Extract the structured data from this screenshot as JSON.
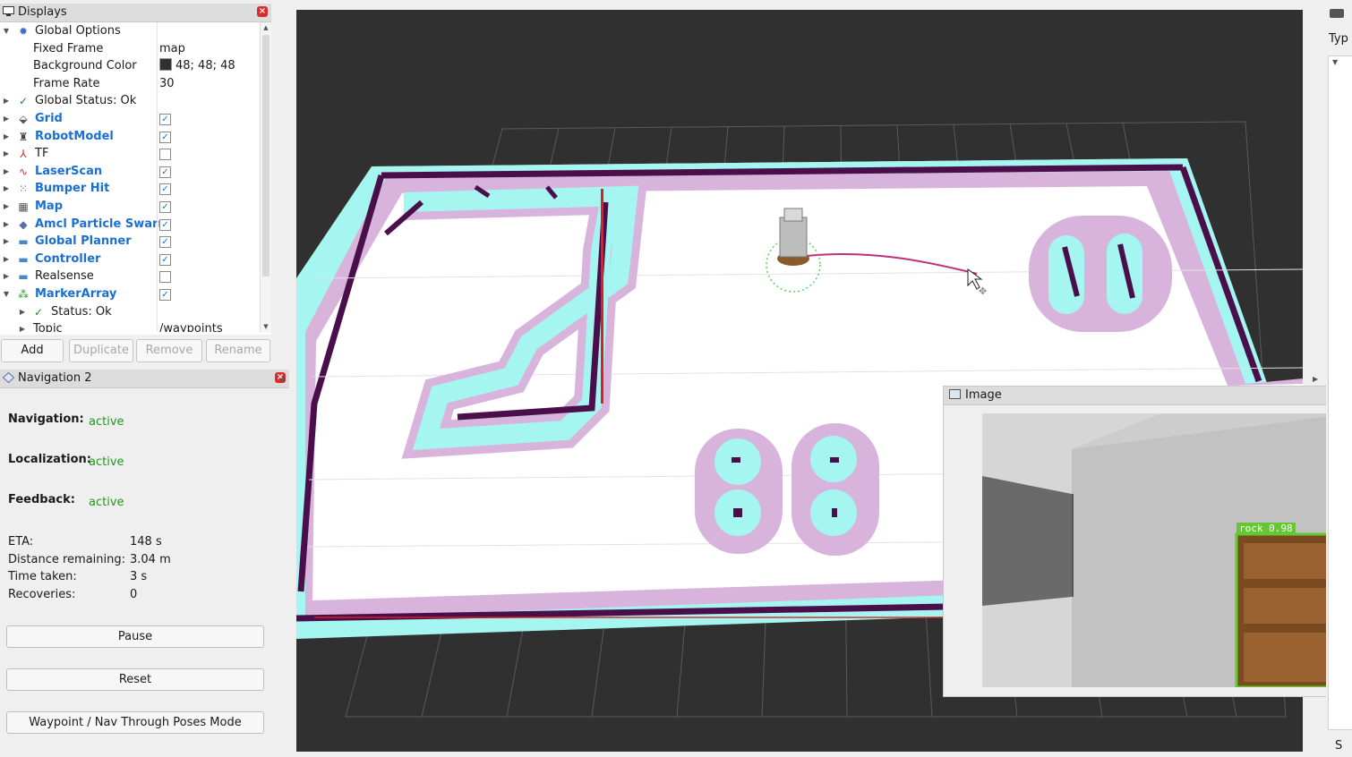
{
  "displays": {
    "title": "Displays",
    "global_options": "Global Options",
    "fixed_frame": {
      "label": "Fixed Frame",
      "value": "map"
    },
    "background_color": {
      "label": "Background Color",
      "value": "48; 48; 48"
    },
    "frame_rate": {
      "label": "Frame Rate",
      "value": "30"
    },
    "global_status": "Global Status: Ok",
    "items": [
      {
        "label": "Grid",
        "checked": true,
        "icon": "grid-icon"
      },
      {
        "label": "RobotModel",
        "checked": true,
        "icon": "robot-icon"
      },
      {
        "label": "TF",
        "checked": false,
        "icon": "axes-icon"
      },
      {
        "label": "LaserScan",
        "checked": true,
        "icon": "laser-icon"
      },
      {
        "label": "Bumper Hit",
        "checked": true,
        "icon": "points-icon"
      },
      {
        "label": "Map",
        "checked": true,
        "icon": "map-icon"
      },
      {
        "label": "Amcl Particle Swarm",
        "checked": true,
        "icon": "diamond-icon"
      },
      {
        "label": "Global Planner",
        "checked": true,
        "icon": "folder-icon"
      },
      {
        "label": "Controller",
        "checked": true,
        "icon": "folder-icon"
      },
      {
        "label": "Realsense",
        "checked": false,
        "icon": "folder-icon"
      },
      {
        "label": "MarkerArray",
        "checked": true,
        "icon": "markers-icon"
      }
    ],
    "marker_status": "Status: Ok",
    "partial_topic_label": "Topic",
    "partial_topic_value": "/waypoints"
  },
  "buttons": {
    "add": "Add",
    "duplicate": "Duplicate",
    "remove": "Remove",
    "rename": "Rename"
  },
  "navigation": {
    "title": "Navigation 2",
    "navigation_label": "Navigation:",
    "navigation_status": "active",
    "localization_label": "Localization:",
    "localization_status": "active",
    "feedback_label": "Feedback:",
    "feedback_status": "active",
    "eta_label": "ETA:",
    "eta_value": "148 s",
    "distance_label": "Distance remaining:",
    "distance_value": "3.04 m",
    "time_label": "Time taken:",
    "time_value": "3 s",
    "recoveries_label": "Recoveries:",
    "recoveries_value": "0",
    "pause": "Pause",
    "reset": "Reset",
    "waypoint_mode": "Waypoint / Nav Through Poses Mode"
  },
  "image_window": {
    "title": "Image",
    "detection_label": "rock",
    "detection_score": "0.98"
  },
  "right_panel": {
    "partial_label": "Typ",
    "bottom_partial": "S"
  },
  "colors": {
    "background": "#303030",
    "costmap_cyan": "#a5f5f0",
    "costmap_pink": "#d8b4dc",
    "obstacle": "#4a0f4a",
    "path": "#c0307a",
    "status_green": "#1e9a1e",
    "link_blue": "#1c6fd1"
  }
}
